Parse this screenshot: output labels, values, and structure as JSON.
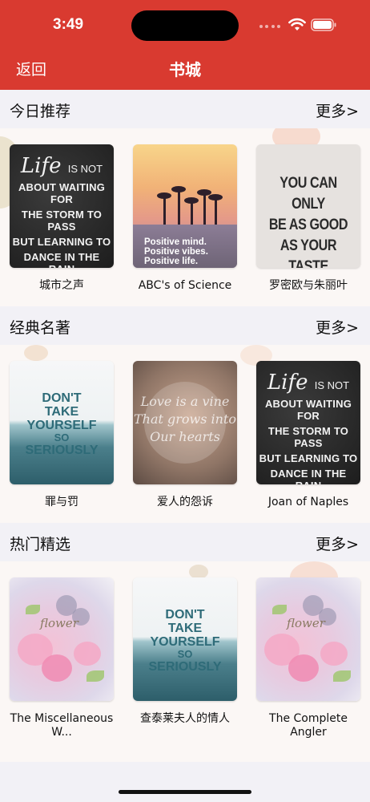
{
  "status_bar": {
    "time": "3:49"
  },
  "nav": {
    "back_label": "返回",
    "title": "书城"
  },
  "sections": [
    {
      "title": "今日推荐",
      "more_label": "更多>",
      "books": [
        {
          "title": "城市之声",
          "cover_text": [
            "Life",
            "IS NOT",
            "ABOUT WAITING FOR",
            "THE STORM TO PASS",
            "BUT LEARNING TO",
            "DANCE IN THE RAIN"
          ]
        },
        {
          "title": "ABC's of Science",
          "cover_text": [
            "Positive mind.",
            "Positive vibes.",
            "Positive life."
          ]
        },
        {
          "title": "罗密欧与朱丽叶",
          "cover_text": [
            "YOU CAN ONLY",
            "BE AS GOOD",
            "AS YOUR TASTE"
          ]
        }
      ]
    },
    {
      "title": "经典名著",
      "more_label": "更多>",
      "books": [
        {
          "title": "罪与罚",
          "cover_text": [
            "DON'T",
            "TAKE YOURSELF",
            "SO",
            "SERIOUSLY"
          ]
        },
        {
          "title": "爱人的怨诉",
          "cover_text": [
            "Love is a vine",
            "That grows into",
            "Our hearts"
          ]
        },
        {
          "title": "Joan of Naples",
          "cover_text": [
            "Life",
            "IS NOT",
            "ABOUT WAITING FOR",
            "THE STORM TO PASS",
            "BUT LEARNING TO",
            "DANCE IN THE RAIN"
          ]
        }
      ]
    },
    {
      "title": "热门精选",
      "more_label": "更多>",
      "books": [
        {
          "title": "The Miscellaneous W...",
          "cover_text": [
            "flower"
          ]
        },
        {
          "title": "查泰莱夫人的情人",
          "cover_text": [
            "DON'T",
            "TAKE YOURSELF",
            "SO",
            "SERIOUSLY"
          ]
        },
        {
          "title": "The Complete Angler",
          "cover_text": [
            "flower"
          ]
        }
      ]
    }
  ],
  "colors": {
    "nav_bar": "#d93a30",
    "section_header_bg": "#f2f1f6",
    "section_body_bg": "#fbf7f5"
  },
  "icons": [
    "wifi-icon",
    "battery-icon"
  ]
}
